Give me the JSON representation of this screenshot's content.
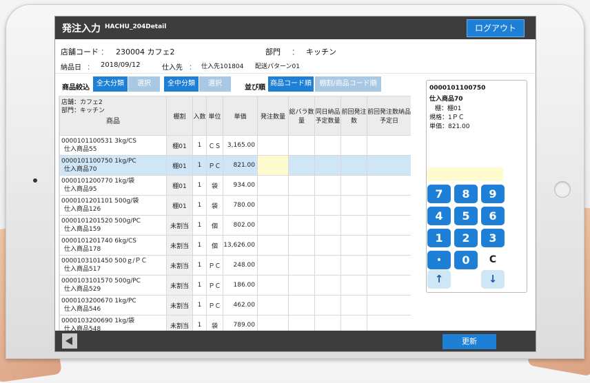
{
  "header": {
    "title": "発注入力",
    "screen_id": "HACHU_204Detail",
    "logout_label": "ログアウト"
  },
  "info": {
    "store_label": "店舗コード",
    "store_value": "230004  カフェ2",
    "dept_label": "部門",
    "dept_value": "キッチン",
    "delivery_label": "納品日",
    "delivery_value": "2018/09/12",
    "supplier_label": "仕入先",
    "supplier_value": "仕入先101804",
    "pattern_label": "配送パターン01",
    "colon": "："
  },
  "filters": {
    "narrow_label": "商品絞込",
    "major_all": "全大分類",
    "major_select": "選択",
    "mid_all": "全中分類",
    "mid_select": "選択",
    "sort_label": "並び順",
    "sort_code": "商品コード順",
    "sort_shelf": "棚割/商品コード順"
  },
  "table": {
    "store_line": "店舗：カフェ2",
    "dept_line": "部門：キッチン",
    "product_header": "商品",
    "headers": [
      "棚割",
      "入数",
      "単位",
      "単価",
      "発注数量",
      "総バラ数量",
      "同日納品予定数量",
      "前回発注数",
      "前回発注数納品予定日"
    ],
    "rows": [
      {
        "code": "0000101100531  3kg/CS",
        "name": "仕入商品55",
        "shelf": "棚01",
        "qty": "1",
        "unit": "ＣＳ",
        "price": "3,165.00"
      },
      {
        "code": "0000101100750  1kg/PC",
        "name": "仕入商品70",
        "shelf": "棚01",
        "qty": "1",
        "unit": "ＰＣ",
        "price": "821.00"
      },
      {
        "code": "0000101200770  1kg/袋",
        "name": "仕入商品95",
        "shelf": "棚01",
        "qty": "1",
        "unit": "袋",
        "price": "934.00"
      },
      {
        "code": "0000101201101  500g/袋",
        "name": "仕入商品126",
        "shelf": "棚01",
        "qty": "1",
        "unit": "袋",
        "price": "780.00"
      },
      {
        "code": "0000101201520  500g/PC",
        "name": "仕入商品159",
        "shelf": "未割当",
        "qty": "1",
        "unit": "個",
        "price": "802.00"
      },
      {
        "code": "0000101201740  6kg/CS",
        "name": "仕入商品178",
        "shelf": "未割当",
        "qty": "1",
        "unit": "個",
        "price": "13,626.00"
      },
      {
        "code": "0000103101450  500ｇ/ＰＣ",
        "name": "仕入商品517",
        "shelf": "未割当",
        "qty": "1",
        "unit": "ＰＣ",
        "price": "248.00"
      },
      {
        "code": "0000103101570  500g/PC",
        "name": "仕入商品529",
        "shelf": "未割当",
        "qty": "1",
        "unit": "ＰＣ",
        "price": "186.00"
      },
      {
        "code": "0000103200670  1kg/PC",
        "name": "仕入商品546",
        "shelf": "未割当",
        "qty": "1",
        "unit": "ＰＣ",
        "price": "462.00"
      },
      {
        "code": "0000103200690  1kg/袋",
        "name": "仕入商品548",
        "shelf": "未割当",
        "qty": "1",
        "unit": "袋",
        "price": "789.00"
      }
    ],
    "selected_index": 1
  },
  "detail": {
    "code": "0000101100750",
    "name": "仕入商品70",
    "shelf_line": "棚：棚01",
    "spec_line": "規格：1ＰＣ",
    "price_line": "単価：821.00"
  },
  "keypad": {
    "keys": [
      "7",
      "8",
      "9",
      "4",
      "5",
      "6",
      "1",
      "2",
      "3",
      "・",
      "0",
      "C"
    ],
    "up": "↑",
    "down": "↓"
  },
  "footer": {
    "update_label": "更新"
  },
  "colors": {
    "accent": "#1e7fd6",
    "accent_light": "#a9c8e3",
    "bar": "#3d3d3d",
    "selected_row": "#cfe6f7",
    "input_bg": "#fffbd0"
  }
}
